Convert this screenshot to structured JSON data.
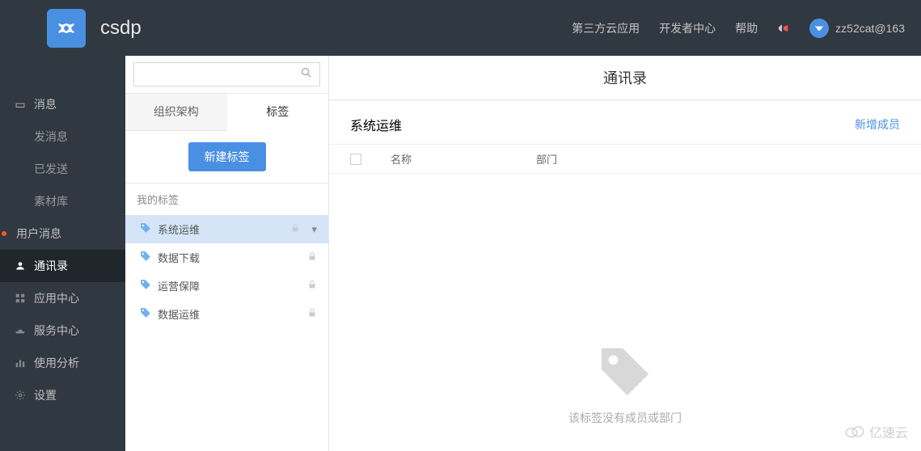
{
  "header": {
    "app_name": "csdp",
    "links": [
      "第三方云应用",
      "开发者中心",
      "帮助"
    ],
    "user": "zz52cat@163"
  },
  "sidebar": {
    "items": [
      {
        "label": "消息",
        "icon": "msg"
      },
      {
        "label": "发消息",
        "sub": true
      },
      {
        "label": "已发送",
        "sub": true
      },
      {
        "label": "素材库",
        "sub": true
      },
      {
        "label": "用户消息",
        "icon": "dot"
      },
      {
        "label": "通讯录",
        "icon": "contacts",
        "active": true
      },
      {
        "label": "应用中心",
        "icon": "apps"
      },
      {
        "label": "服务中心",
        "icon": "service"
      },
      {
        "label": "使用分析",
        "icon": "stats"
      },
      {
        "label": "设置",
        "icon": "gear"
      }
    ]
  },
  "panel": {
    "search_placeholder": "",
    "tabs": {
      "org": "组织架构",
      "tag": "标签"
    },
    "new_tag_btn": "新建标签",
    "section_title": "我的标签",
    "tags": [
      {
        "label": "系统运维",
        "selected": true,
        "menu": true
      },
      {
        "label": "数据下载"
      },
      {
        "label": "运营保障"
      },
      {
        "label": "数据运维"
      }
    ]
  },
  "main": {
    "title": "通讯录",
    "section": "系统运维",
    "add_member": "新增成员",
    "columns": {
      "name": "名称",
      "dept": "部门"
    },
    "empty_text": "该标签没有成员或部门"
  },
  "watermark": "亿速云"
}
